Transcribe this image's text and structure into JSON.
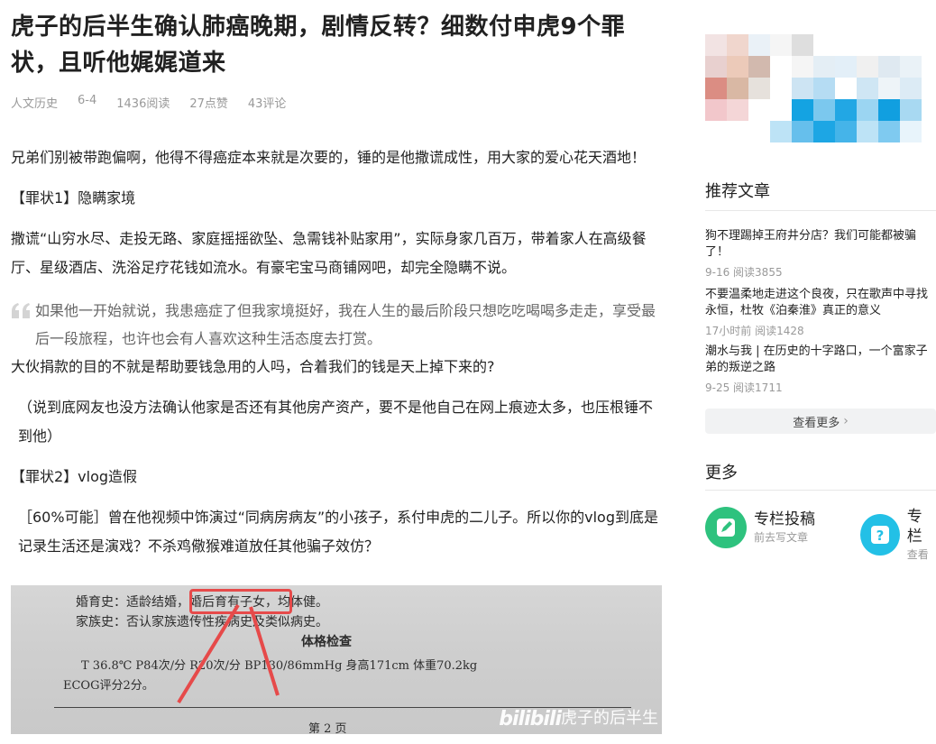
{
  "article": {
    "title": "虎子的后半生确认肺癌晚期，剧情反转？细数付申虎9个罪状，且听他娓娓道来",
    "meta": {
      "category": "人文历史",
      "date": "6-4",
      "reads": "1436阅读",
      "likes": "27点赞",
      "comments": "43评论"
    },
    "paragraphs": {
      "p1": "兄弟们别被带跑偏啊，他得不得癌症本来就是次要的，锤的是他撒谎成性，用大家的爱心花天酒地！",
      "p2": "【罪状1】隐瞒家境",
      "p3": "撒谎“山穷水尽、走投无路、家庭摇摇欲坠、急需钱补贴家用”，实际身家几百万，带着家人在高级餐厅、星级酒店、洗浴足疗花钱如流水。有豪宅宝马商铺网吧，却完全隐瞒不说。",
      "quote": "如果他一开始就说，我患癌症了但我家境挺好，我在人生的最后阶段只想吃吃喝喝多走走，享受最后一段旅程，也许也会有人喜欢这种生活态度去打赏。",
      "p4": "大伙捐款的目的不就是帮助要钱急用的人吗，合着我们的钱是天上掉下来的?",
      "p5": "（说到底网友也没方法确认他家是否还有其他房产资产，要不是他自己在网上痕迹太多，也压根锤不到他）",
      "p6": "【罪状2】vlog造假",
      "p7": "［60%可能］曾在他视频中饰演过“同病房病友”的小孩子，系付申虎的二儿子。所以你的vlog到底是记录生活还是演戏？不杀鸡儆猴难道放任其他骗子效仿？"
    },
    "image": {
      "line1": "婚育史：适龄结婚，婚后育有子女，均体健。",
      "line2": "家族史：否认家族遗传性疾病史及类似病史。",
      "line3": "体格检查",
      "line4": "T 36.8℃    P84次/分    R20次/分    BP130/86mmHg    身高171cm    体重70.2kg",
      "line5": "ECOG评分2分。",
      "line6": "第 2 页",
      "logo": "bilibili",
      "watermark": "虎子的后半生"
    }
  },
  "sidebar": {
    "recommended_title": "推荐文章",
    "recommended": [
      {
        "title": "狗不理踢掉王府井分店？我们可能都被骗了！",
        "meta": "9-16 阅读3855"
      },
      {
        "title": "不要温柔地走进这个良夜，只在歌声中寻找永恒，杜牧《泊秦淮》真正的意义",
        "meta": "17小时前 阅读1428"
      },
      {
        "title": "潮水与我 | 在历史的十字路口，一个富家子弟的叛逆之路",
        "meta": "9-25 阅读1711"
      }
    ],
    "more_button": "查看更多",
    "more_title": "更多",
    "tools": [
      {
        "name": "专栏投稿",
        "sub": "前去写文章",
        "icon": "pencil-icon",
        "color": "#2ec27e"
      },
      {
        "name": "专栏",
        "sub": "查看",
        "icon": "question-icon",
        "color": "#23c0e6"
      }
    ]
  }
}
